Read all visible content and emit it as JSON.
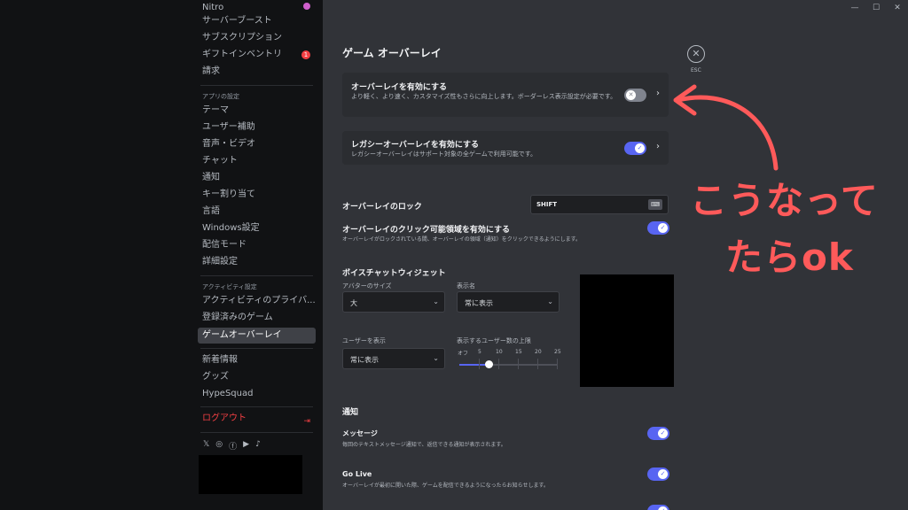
{
  "sidebar": {
    "items_top": [
      {
        "label": "Nitro"
      },
      {
        "label": "サーバーブースト"
      },
      {
        "label": "サブスクリプション"
      },
      {
        "label": "ギフトインベントリ",
        "badge": "1"
      },
      {
        "label": "請求"
      }
    ],
    "app_settings_header": "アプリの設定",
    "app_settings": [
      {
        "label": "テーマ"
      },
      {
        "label": "ユーザー補助"
      },
      {
        "label": "音声・ビデオ"
      },
      {
        "label": "チャット"
      },
      {
        "label": "通知"
      },
      {
        "label": "キー割り当て"
      },
      {
        "label": "言語"
      },
      {
        "label": "Windows設定"
      },
      {
        "label": "配信モード"
      },
      {
        "label": "詳細設定"
      }
    ],
    "activity_header": "アクティビティ設定",
    "activity": [
      {
        "label": "アクティビティのプライバ..."
      },
      {
        "label": "登録済みのゲーム"
      },
      {
        "label": "ゲームオーバーレイ",
        "active": true
      }
    ],
    "misc": [
      {
        "label": "新着情報"
      },
      {
        "label": "グッズ"
      },
      {
        "label": "HypeSquad"
      }
    ],
    "logout": "ログアウト",
    "social_icons": [
      "x-icon",
      "instagram-icon",
      "facebook-icon",
      "youtube-icon",
      "tiktok-icon"
    ]
  },
  "window": {
    "minimize": "—",
    "maximize": "☐",
    "close": "✕"
  },
  "main": {
    "title": "ゲーム オーバーレイ",
    "esc_label": "ESC",
    "overlay_enable": {
      "title": "オーバーレイを有効にする",
      "desc": "より軽く、より速く、カスタマイズ性もさらに向上します。ボーダーレス表示設定が必要です。",
      "enabled": false
    },
    "legacy_overlay": {
      "title": "レガシーオーバーレイを有効にする",
      "desc": "レガシーオーバーレイはサポート対象の全ゲームで利用可能です。",
      "enabled": true
    },
    "overlay_lock": {
      "title": "オーバーレイのロック",
      "key": "SHIFT"
    },
    "click_area": {
      "title": "オーバーレイのクリック可能領域を有効にする",
      "desc": "オーバーレイがロックされている間、オーバーレイの領域（通知）をクリックできるようにします。",
      "enabled": true
    },
    "voice_widget": {
      "title": "ボイスチャットウィジェット",
      "avatar_size_label": "アバターのサイズ",
      "avatar_size_value": "大",
      "display_name_label": "表示名",
      "display_name_value": "常に表示",
      "show_users_label": "ユーザーを表示",
      "show_users_value": "常に表示",
      "max_users_label": "表示するユーザー数の上限",
      "slider_ticks": [
        "オフ",
        "5",
        "10",
        "15",
        "20",
        "25"
      ],
      "slider_value_fraction": 0.3
    },
    "notifications": {
      "title": "通知",
      "message": {
        "title": "メッセージ",
        "desc": "毎回のテキストメッセージ通知で、返信できる通知が表示されます。",
        "enabled": true
      },
      "golive": {
        "title": "Go Live",
        "desc": "オーバーレイが最初に開いた際、ゲームを配信できるようになったらお知らせします。",
        "enabled": true
      }
    }
  },
  "annotation": {
    "line1": "こうなって",
    "line2": "たらok",
    "color": "#ff5a5a"
  }
}
